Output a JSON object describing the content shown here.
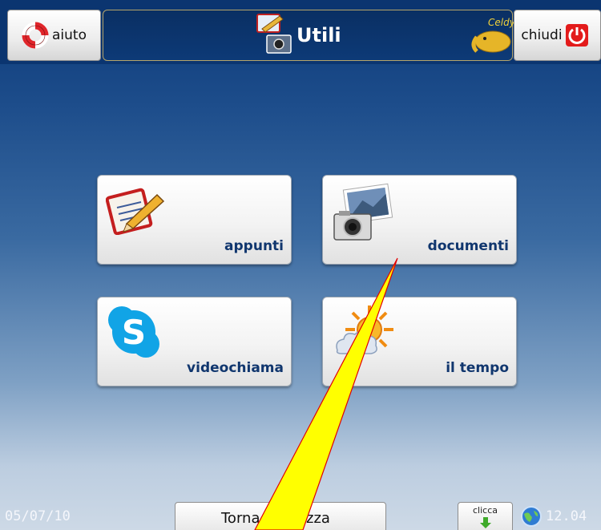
{
  "header": {
    "help_label": "aiuto",
    "title": "Utili",
    "logo_text": "Celdy",
    "close_label": "chiudi"
  },
  "tiles": [
    {
      "label": "appunti",
      "icon": "notepad-pencil-icon"
    },
    {
      "label": "documenti",
      "icon": "camera-photo-icon"
    },
    {
      "label": "videochiama",
      "icon": "skype-icon"
    },
    {
      "label": "il tempo",
      "icon": "weather-sun-cloud-icon"
    }
  ],
  "footer": {
    "date": "05/07/10",
    "back_label": "Torna alla piazza",
    "back_label_visible": [
      "Torna",
      "azza"
    ],
    "click_label": "clicca",
    "time": "12.04"
  },
  "colors": {
    "background_top": "#0c3a79",
    "background_bottom": "#cdd9e6",
    "tile_label": "#10366e",
    "annotation_fill": "#ffff00",
    "annotation_stroke": "#e00000"
  }
}
